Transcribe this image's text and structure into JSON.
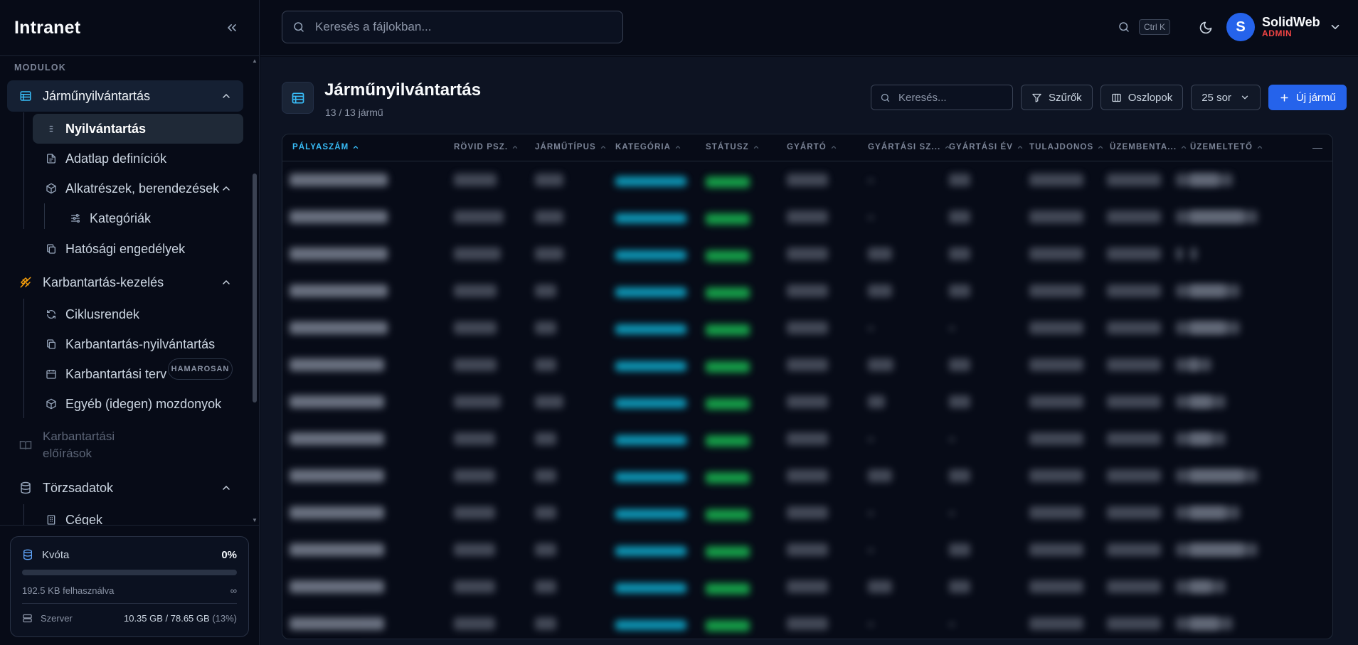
{
  "app": {
    "brand": "Intranet"
  },
  "sidebar": {
    "section_label": "MODULOK",
    "groups": [
      {
        "label": "Járműnyilvántartás",
        "icon": "table-list-icon",
        "expanded": true,
        "items": [
          {
            "label": "Nyilvántartás",
            "icon": "list-icon",
            "active": true
          },
          {
            "label": "Adatlap definíciók",
            "icon": "document-icon"
          },
          {
            "label": "Alkatrészek, berendezések",
            "icon": "cube-icon",
            "expanded": true,
            "children": [
              {
                "label": "Kategóriák",
                "icon": "sliders-icon"
              }
            ]
          },
          {
            "label": "Hatósági engedélyek",
            "icon": "copy-icon"
          }
        ]
      },
      {
        "label": "Karbantartás-kezelés",
        "icon": "tools-icon",
        "expanded": true,
        "items": [
          {
            "label": "Ciklusrendek",
            "icon": "refresh-icon"
          },
          {
            "label": "Karbantartás-nyilvántartás",
            "icon": "copy-icon"
          },
          {
            "label": "Karbantartási terv",
            "icon": "calendar-icon"
          },
          {
            "label": "Egyéb (idegen) mozdonyok",
            "icon": "cube-icon"
          }
        ]
      },
      {
        "label_line1": "Karbantartási",
        "label_line2": "előírások",
        "icon": "book-icon",
        "disabled": true,
        "badge": "HAMAROSAN"
      },
      {
        "label": "Törzsadatok",
        "icon": "database-icon",
        "expanded": true,
        "items": [
          {
            "label": "Cégek",
            "icon": "building-icon"
          }
        ]
      }
    ],
    "quota": {
      "title": "Kvóta",
      "percent_label": "0%",
      "percent": 0,
      "used": "192.5 KB felhasználva",
      "limit_symbol": "∞",
      "server_label": "Szerver",
      "server_usage": "10.35 GB / 78.65 GB",
      "server_pct": "(13%)"
    }
  },
  "topbar": {
    "file_search_placeholder": "Keresés a fájlokban...",
    "shortcut": "Ctrl K",
    "user": {
      "initial": "S",
      "name": "SolidWeb",
      "role": "ADMIN"
    }
  },
  "page": {
    "title": "Járműnyilvántartás",
    "count": "13 / 13 jármű",
    "toolbar": {
      "search_placeholder": "Keresés...",
      "filters": "Szűrők",
      "columns": "Oszlopok",
      "rows_per_page": "25 sor",
      "new": "Új jármű"
    },
    "table": {
      "columns": [
        {
          "label": "PÁLYASZÁM",
          "sorted": true
        },
        {
          "label": "RÖVID PSZ."
        },
        {
          "label": "JÁRMŰTÍPUS"
        },
        {
          "label": "KATEGÓRIA"
        },
        {
          "label": "STÁTUSZ"
        },
        {
          "label": "GYÁRTÓ"
        },
        {
          "label": "GYÁRTÁSI SZ..."
        },
        {
          "label": "GYÁRTÁSI ÉV"
        },
        {
          "label": "TULAJDONOS"
        },
        {
          "label": "ÜZEMBENTA..."
        },
        {
          "label": "ÜZEMELTETŐ"
        }
      ],
      "row_count": 13
    }
  },
  "colors": {
    "accent": "#38bdf8",
    "primary": "#2563eb",
    "admin": "#ef4444",
    "status_active": "#16a34a",
    "category": "#0ea5c6"
  }
}
